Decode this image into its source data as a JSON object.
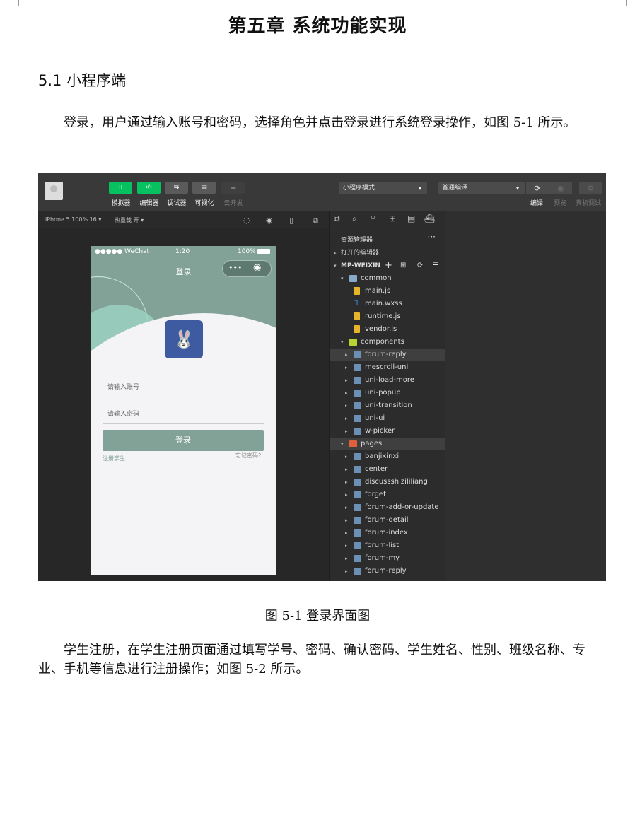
{
  "chapter_title": "第五章 系统功能实现",
  "section_title": "5.1 小程序端",
  "paragraph1": "登录，用户通过输入账号和密码，选择角色并点击登录进行系统登录操作，如图 5-1 所示。",
  "figure_caption": "图 5-1 登录界面图",
  "paragraph2": "学生注册，在学生注册页面通过填写学号、密码、确认密码、学生姓名、性别、班级名称、专业、手机等信息进行注册操作；如图 5-2 所示。",
  "ide": {
    "toolbar": {
      "simulator": "模拟器",
      "editor": "编辑器",
      "debugger": "调试器",
      "visual": "可视化",
      "cloud": "云开发",
      "mode_select": "小程序模式",
      "compile_select": "普通编译",
      "compile": "编译",
      "preview": "预览",
      "real_debug": "真机调试"
    },
    "subbar": {
      "device": "iPhone 5 100% 16 ▾",
      "hot_reload": "热重载 开 ▾"
    },
    "phone": {
      "carrier": "●●●●● WeChat",
      "time": "1:20",
      "battery": "100%",
      "nav_title": "登录",
      "account_placeholder": "请输入账号",
      "password_placeholder": "请输入密码",
      "login_button": "登录",
      "register_link": "注册学生",
      "forgot_link": "忘记密码?"
    },
    "explorer": {
      "title": "资源管理器",
      "open_editors": "打开的编辑器",
      "project": "MP-WEIXIN",
      "tree": [
        {
          "label": "common",
          "depth": 1,
          "type": "folder-open",
          "arrow": "▾"
        },
        {
          "label": "main.js",
          "depth": 2,
          "type": "js",
          "arrow": ""
        },
        {
          "label": "main.wxss",
          "depth": 2,
          "type": "css",
          "arrow": ""
        },
        {
          "label": "runtime.js",
          "depth": 2,
          "type": "js",
          "arrow": ""
        },
        {
          "label": "vendor.js",
          "depth": 2,
          "type": "js",
          "arrow": ""
        },
        {
          "label": "components",
          "depth": 1,
          "type": "comp",
          "arrow": "▾"
        },
        {
          "label": "forum-reply",
          "depth": 2,
          "type": "folder",
          "arrow": "▸",
          "selected": true
        },
        {
          "label": "mescroll-uni",
          "depth": 2,
          "type": "folder",
          "arrow": "▸"
        },
        {
          "label": "uni-load-more",
          "depth": 2,
          "type": "folder",
          "arrow": "▸"
        },
        {
          "label": "uni-popup",
          "depth": 2,
          "type": "folder",
          "arrow": "▸"
        },
        {
          "label": "uni-transition",
          "depth": 2,
          "type": "folder",
          "arrow": "▸"
        },
        {
          "label": "uni-ui",
          "depth": 2,
          "type": "folder",
          "arrow": "▸"
        },
        {
          "label": "w-picker",
          "depth": 2,
          "type": "folder",
          "arrow": "▸"
        },
        {
          "label": "pages",
          "depth": 1,
          "type": "pages",
          "arrow": "▾",
          "selected": true
        },
        {
          "label": "banjixinxi",
          "depth": 2,
          "type": "folder",
          "arrow": "▸"
        },
        {
          "label": "center",
          "depth": 2,
          "type": "folder",
          "arrow": "▸"
        },
        {
          "label": "discussshizililiang",
          "depth": 2,
          "type": "folder",
          "arrow": "▸"
        },
        {
          "label": "forget",
          "depth": 2,
          "type": "folder",
          "arrow": "▸"
        },
        {
          "label": "forum-add-or-update",
          "depth": 2,
          "type": "folder",
          "arrow": "▸"
        },
        {
          "label": "forum-detail",
          "depth": 2,
          "type": "folder",
          "arrow": "▸"
        },
        {
          "label": "forum-index",
          "depth": 2,
          "type": "folder",
          "arrow": "▸"
        },
        {
          "label": "forum-list",
          "depth": 2,
          "type": "folder",
          "arrow": "▸"
        },
        {
          "label": "forum-my",
          "depth": 2,
          "type": "folder",
          "arrow": "▸"
        },
        {
          "label": "forum-reply",
          "depth": 2,
          "type": "folder",
          "arrow": "▸"
        }
      ]
    },
    "colors": {
      "accent_green": "#07c160",
      "theme_green": "#83a297"
    }
  }
}
